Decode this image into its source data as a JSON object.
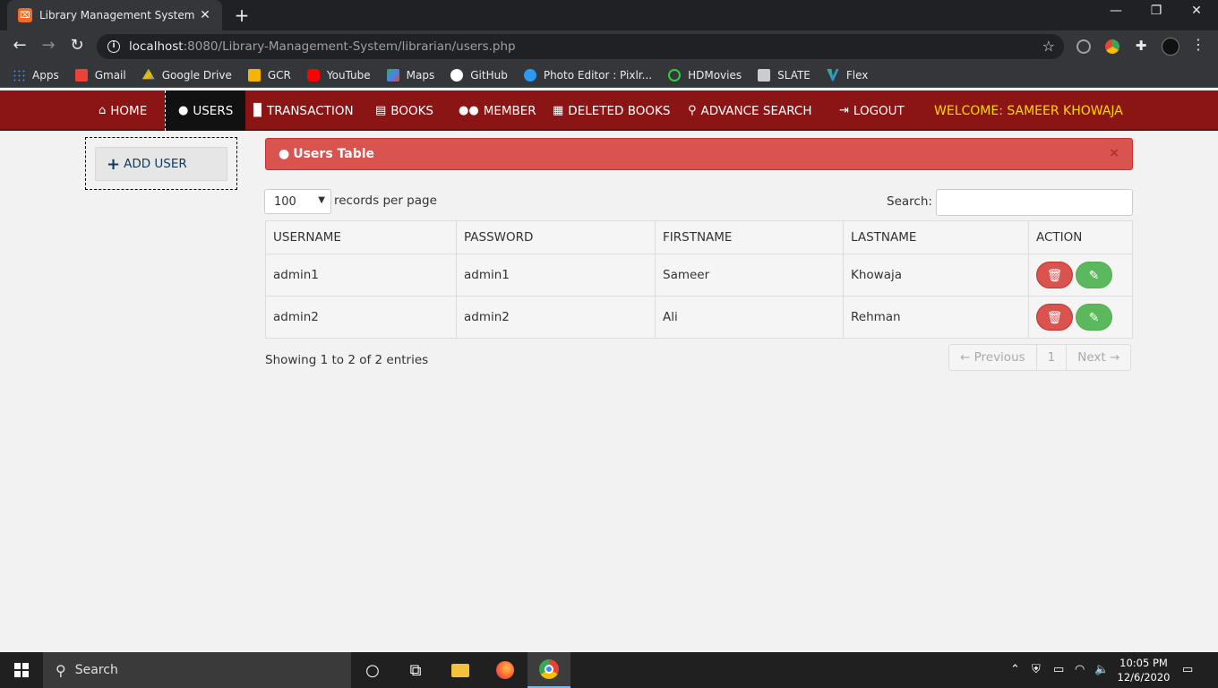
{
  "browser": {
    "tab_title": "Library Management System",
    "tab_favicon": "xampp-icon",
    "url_host": "localhost",
    "url_rest": ":8080/Library-Management-System/librarian/users.php",
    "bookmarks": [
      {
        "label": "Apps",
        "icon": "apps-grid-icon",
        "color": "#4285f4"
      },
      {
        "label": "Gmail",
        "icon": "gmail-icon",
        "color": "#ea4335"
      },
      {
        "label": "Google Drive",
        "icon": "google-drive-icon",
        "color": "#fbbc04"
      },
      {
        "label": "GCR",
        "icon": "classroom-icon",
        "color": "#f4b400"
      },
      {
        "label": "YouTube",
        "icon": "youtube-icon",
        "color": "#ff0000"
      },
      {
        "label": "Maps",
        "icon": "maps-icon",
        "color": "#34a853"
      },
      {
        "label": "GitHub",
        "icon": "github-icon",
        "color": "#ffffff"
      },
      {
        "label": "Photo Editor : Pixlr...",
        "icon": "pixlr-icon",
        "color": "#2b9af3"
      },
      {
        "label": "HDMovies",
        "icon": "hdmovies-icon",
        "color": "#2ecc40"
      },
      {
        "label": "SLATE",
        "icon": "slate-icon",
        "color": "#cccccc"
      },
      {
        "label": "Flex",
        "icon": "flex-icon",
        "color": "#36b37e"
      }
    ]
  },
  "navbar": {
    "items": [
      {
        "label": "HOME",
        "icon": "home-icon"
      },
      {
        "label": "USERS",
        "icon": "user-icon"
      },
      {
        "label": "TRANSACTION",
        "icon": "file-icon"
      },
      {
        "label": "BOOKS",
        "icon": "book-icon"
      },
      {
        "label": "MEMBER",
        "icon": "users-icon"
      },
      {
        "label": "DELETED BOOKS",
        "icon": "list-icon"
      },
      {
        "label": "ADVANCE SEARCH",
        "icon": "search-icon"
      },
      {
        "label": "LOGOUT",
        "icon": "sign-out-icon"
      }
    ],
    "welcome": "WELCOME: SAMEER KHOWAJA",
    "bg_color": "#8b1515",
    "welcome_color": "#ffd700"
  },
  "sidebar": {
    "add_user_label": "ADD USER"
  },
  "panel": {
    "title": "Users Table",
    "close": "×"
  },
  "controls": {
    "page_length": "100",
    "records_label": "records per page",
    "search_label": "Search:"
  },
  "table": {
    "headers": [
      "USERNAME",
      "PASSWORD",
      "FIRSTNAME",
      "LASTNAME",
      "ACTION"
    ],
    "rows": [
      [
        "admin1",
        "admin1",
        "Sameer",
        "Khowaja"
      ],
      [
        "admin2",
        "admin2",
        "Ali",
        "Rehman"
      ]
    ]
  },
  "footer": {
    "info": "Showing 1 to 2 of 2 entries",
    "prev": "← Previous",
    "page": "1",
    "next": "Next →"
  },
  "taskbar": {
    "search_placeholder": "Search",
    "time": "10:05 PM",
    "date": "12/6/2020"
  }
}
